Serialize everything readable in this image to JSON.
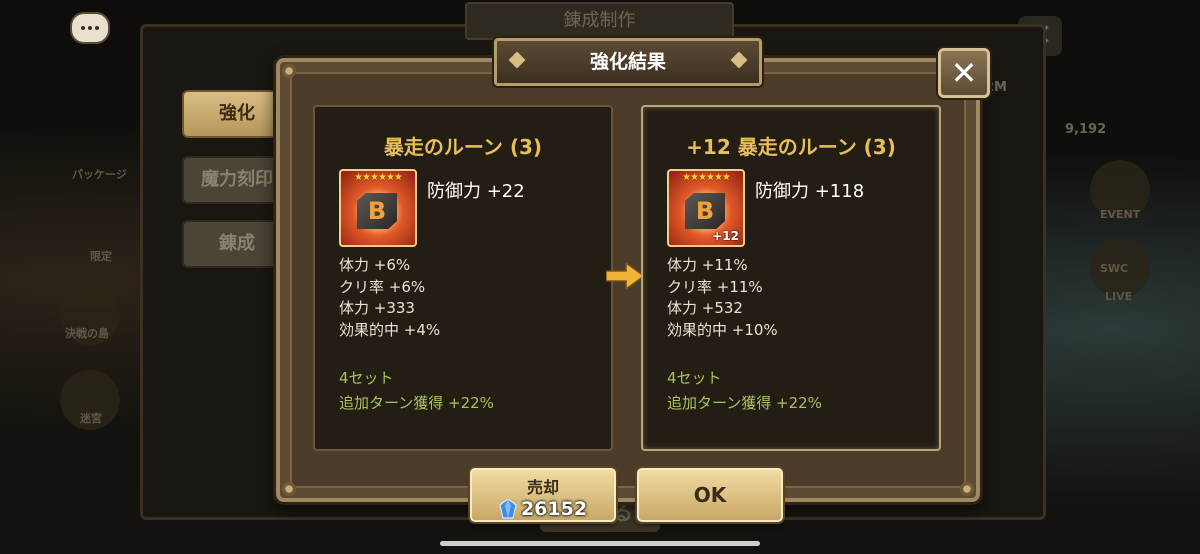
{
  "background": {
    "title_plate": "錬成制作",
    "close_glyph": "✕",
    "close_label": "閉じる",
    "resource_value": "2M",
    "count_value": "9,192",
    "labels": [
      "EVENT",
      "SWC",
      "LIVE",
      "決戦の島",
      "迷宮",
      "限定",
      "パッケージ"
    ]
  },
  "tabs": [
    {
      "label": "強化",
      "active": true
    },
    {
      "label": "魔力刻印",
      "active": false
    },
    {
      "label": "錬成",
      "active": false
    }
  ],
  "modal": {
    "title": "強化結果",
    "close_glyph": "✕"
  },
  "before": {
    "title": "暴走のルーン (3)",
    "main_stat": "防御力 +22",
    "sub_stats": [
      "体力 +6%",
      "クリ率 +6%",
      "体力 +333",
      "効果的中 +4%"
    ],
    "set_name": "4セット",
    "set_effect": "追加ターン獲得 +22%",
    "stars": "★★★★★★",
    "rune_letter": "B",
    "rune_plus": ""
  },
  "after": {
    "title": "+12 暴走のルーン (3)",
    "main_stat": "防御力 +118",
    "sub_stats": [
      "体力 +11%",
      "クリ率 +11%",
      "体力 +532",
      "効果的中 +10%"
    ],
    "set_name": "4セット",
    "set_effect": "追加ターン獲得 +22%",
    "stars": "★★★★★★",
    "rune_letter": "B",
    "rune_plus": "+12"
  },
  "buttons": {
    "sell_label": "売却",
    "sell_price": "26152",
    "ok_label": "OK"
  },
  "colors": {
    "title_gold": "#e6bf5a",
    "set_green": "#a7c45a",
    "button_gold": "#f2dba1"
  },
  "icons": {
    "chat": "chat-bubble-icon",
    "arrow": "arrow-right-icon",
    "crystal": "crystal-icon",
    "close": "close-icon"
  }
}
